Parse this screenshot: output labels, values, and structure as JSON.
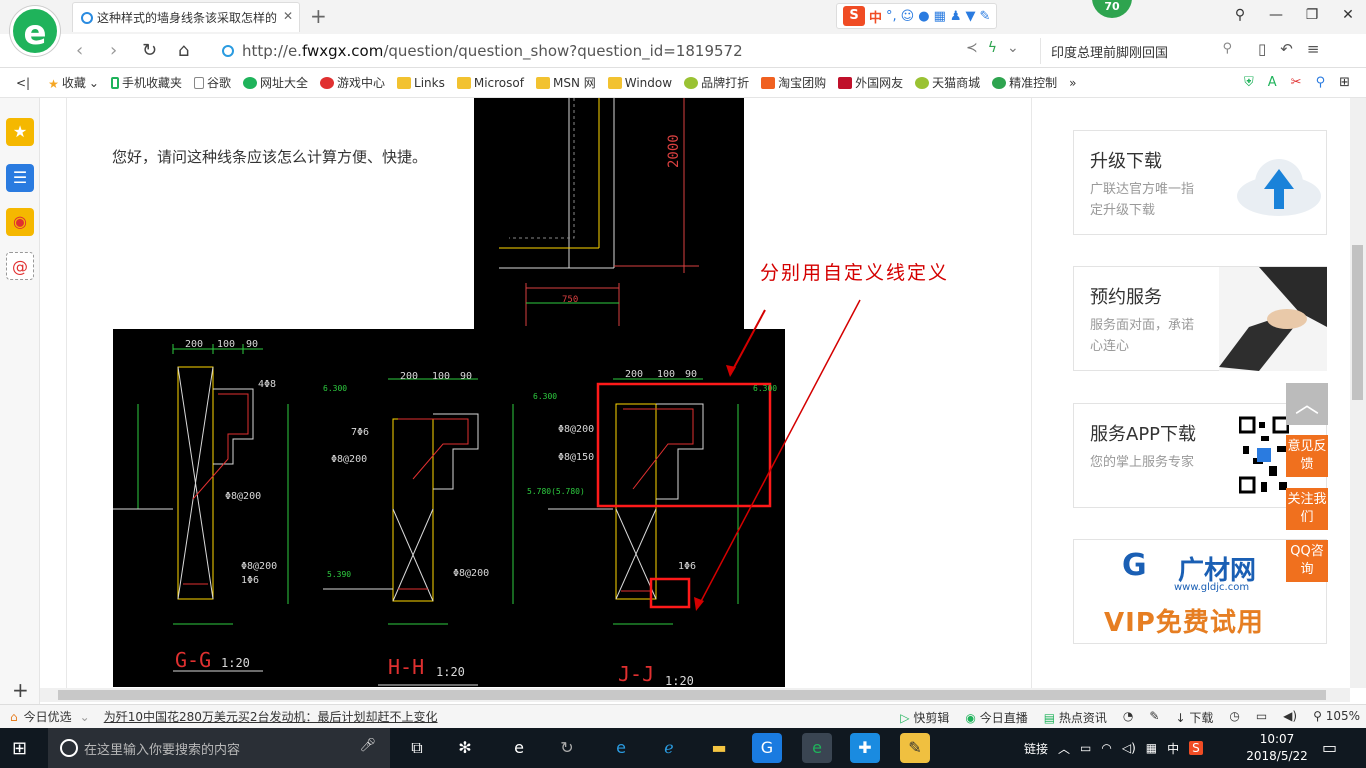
{
  "browser": {
    "tab_title": "这种样式的墙身线条该采取怎样的",
    "url_prefix": "http://e.",
    "url_domain": "fwxgx.com",
    "url_path": "/question/question_show?question_id=1819572",
    "search_text": "印度总理前脚刚回国",
    "badge": "70",
    "sogou_lang": "中"
  },
  "bookmarks": [
    "收藏",
    "手机收藏夹",
    "谷歌",
    "网址大全",
    "游戏中心",
    "Links",
    "Microsof",
    "MSN 网",
    "Window",
    "品牌打折",
    "淘宝团购",
    "外国网友",
    "天猫商城",
    "精准控制"
  ],
  "content": {
    "question": "您好，请问这种线条应该怎么计算方便、快捷。",
    "annotation": "分别用自定义线定义"
  },
  "cad": {
    "dims_top": [
      "200",
      "100",
      "90"
    ],
    "section_labels": [
      "G-G",
      "H-H",
      "J-J"
    ],
    "scale": "1:20",
    "rebar": [
      "4Φ8",
      "7Φ6",
      "Φ8@200",
      "Φ8@200",
      "Φ8@150",
      "Φ8@200",
      "1Φ6",
      "Φ8@200",
      "Φ8@200",
      "1Φ6"
    ],
    "elev": [
      "6.300",
      "6.300",
      "6.300",
      "5.390",
      "5.780(5.780)"
    ],
    "dims": [
      "2000",
      "750"
    ]
  },
  "cards": [
    {
      "title": "升级下载",
      "desc": "广联达官方唯一指定升级下载"
    },
    {
      "title": "预约服务",
      "desc": "服务面对面，承诺心连心"
    },
    {
      "title": "服务APP下载",
      "desc": "您的掌上服务专家"
    },
    {
      "brand": "广材网",
      "domain": "www.gldjc.com",
      "promo": "VIP免费试用"
    }
  ],
  "float_buttons": [
    "意见反馈",
    "关注我们",
    "QQ咨询"
  ],
  "status": {
    "today": "今日优选",
    "news": "为歼10中国花280万美元买2台发动机：最后计划却赶不上变化",
    "items": [
      "快剪辑",
      "今日直播",
      "热点资讯",
      "下载"
    ],
    "zoom": "105%"
  },
  "taskbar": {
    "search_placeholder": "在这里输入你要搜索的内容",
    "link_label": "链接",
    "ime": "中",
    "time": "10:07",
    "date": "2018/5/22"
  },
  "colors": {
    "accent": "#1fb35b",
    "annotation": "#d40000",
    "float": "#f0701e",
    "taskbar": "#101820"
  }
}
